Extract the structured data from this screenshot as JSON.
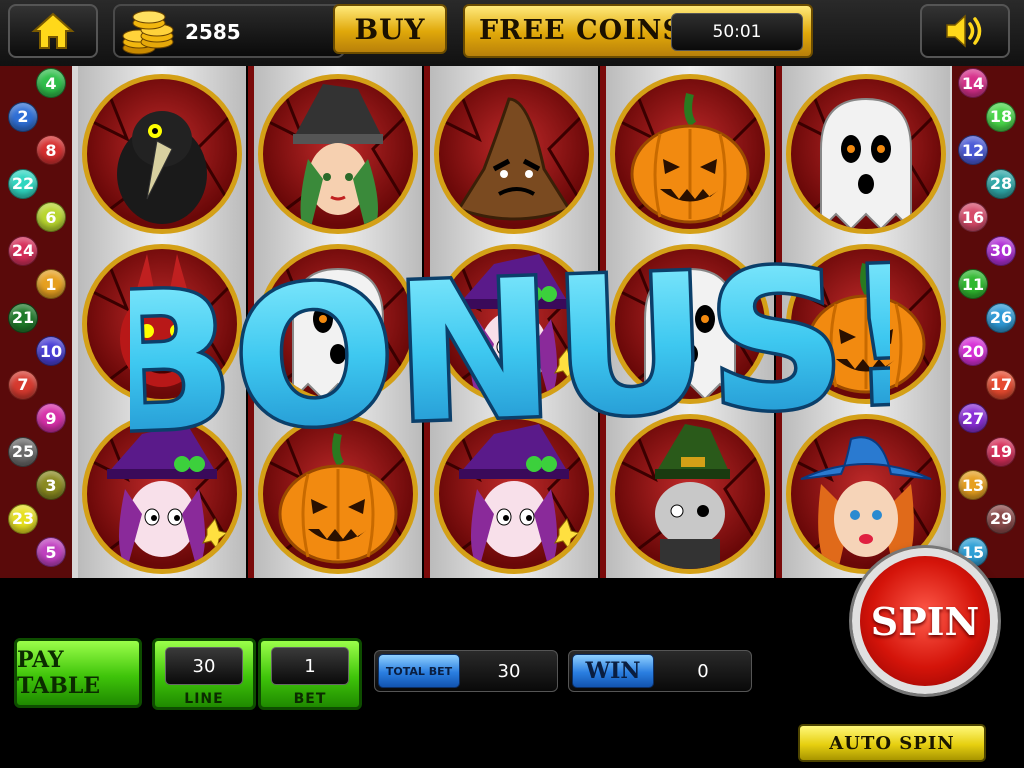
{
  "header": {
    "coins": "2585",
    "buy_label": "BUY",
    "free_coins_label": "FREE COINS",
    "free_coins_timer": "50:01"
  },
  "paylines_left": [
    {
      "n": "4",
      "color": "#2fbf4a"
    },
    {
      "n": "2",
      "color": "#2f6fd6"
    },
    {
      "n": "8",
      "color": "#d62f2f"
    },
    {
      "n": "22",
      "color": "#2fd6c0"
    },
    {
      "n": "6",
      "color": "#b8d62f"
    },
    {
      "n": "24",
      "color": "#d62f5a"
    },
    {
      "n": "1",
      "color": "#e6a020"
    },
    {
      "n": "21",
      "color": "#1f7a2a"
    },
    {
      "n": "10",
      "color": "#4a3fd6"
    },
    {
      "n": "7",
      "color": "#d63a2f"
    },
    {
      "n": "9",
      "color": "#d62fa8"
    },
    {
      "n": "25",
      "color": "#6a6a6a"
    },
    {
      "n": "3",
      "color": "#8a8a20"
    },
    {
      "n": "23",
      "color": "#e6e020"
    },
    {
      "n": "5",
      "color": "#c040c0"
    }
  ],
  "paylines_right": [
    {
      "n": "14",
      "color": "#d62f8a"
    },
    {
      "n": "18",
      "color": "#4ad64a"
    },
    {
      "n": "12",
      "color": "#4a5ad6"
    },
    {
      "n": "28",
      "color": "#2fa8a8"
    },
    {
      "n": "16",
      "color": "#d64a6a"
    },
    {
      "n": "30",
      "color": "#b02fd6"
    },
    {
      "n": "11",
      "color": "#2fb82f"
    },
    {
      "n": "26",
      "color": "#2f9ad6"
    },
    {
      "n": "20",
      "color": "#d62fd6"
    },
    {
      "n": "17",
      "color": "#e64a2f"
    },
    {
      "n": "27",
      "color": "#8a2fd6"
    },
    {
      "n": "19",
      "color": "#d62f5a"
    },
    {
      "n": "13",
      "color": "#e6a020"
    },
    {
      "n": "29",
      "color": "#8a4a4a"
    },
    {
      "n": "15",
      "color": "#2fa0d6"
    }
  ],
  "reels": [
    [
      "crow-symbol",
      "devil-symbol",
      "purple-witch-symbol"
    ],
    [
      "witch-symbol",
      "ghost-symbol",
      "pumpkin-symbol"
    ],
    [
      "sorting-hat-symbol",
      "purple-witch-symbol",
      "purple-witch-symbol"
    ],
    [
      "pumpkin-symbol",
      "ghost-symbol",
      "cat-witch-symbol"
    ],
    [
      "ghost-symbol",
      "pumpkin-symbol",
      "blue-witch-symbol"
    ]
  ],
  "bonus_text": "BONUS!",
  "controls": {
    "pay_table_label": "PAY TABLE",
    "line_value": "30",
    "line_label": "LINE",
    "bet_value": "1",
    "bet_label": "BET",
    "total_bet_label": "TOTAL BET",
    "total_bet_value": "30",
    "win_label": "WIN",
    "win_value": "0",
    "spin_label": "SPIN",
    "auto_spin_label": "AUTO SPIN"
  },
  "colors": {
    "gold": "#e0a80a",
    "green": "#3fc40a",
    "spin_red": "#d4140a",
    "bonus_blue": "#3ec8f0",
    "reel_frame": "#d4a017"
  }
}
